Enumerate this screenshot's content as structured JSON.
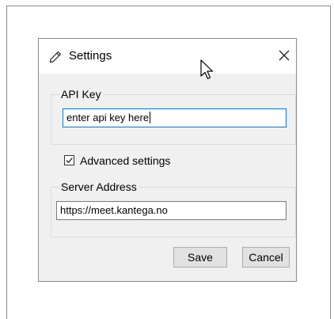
{
  "dialog": {
    "title": "Settings",
    "title_icon": "pencil-icon",
    "close_icon": "close-icon"
  },
  "api_key": {
    "group_label": "API Key",
    "value": "enter api key here"
  },
  "advanced": {
    "label": "Advanced settings",
    "checked": true
  },
  "server": {
    "group_label": "Server Address",
    "value": "https://meet.kantega.no"
  },
  "buttons": {
    "save_label": "Save",
    "cancel_label": "Cancel"
  },
  "colors": {
    "focus_border": "#0078d7",
    "dialog_bg": "#f0f0f0",
    "titlebar_bg": "#ffffff",
    "button_bg": "#e1e1e1"
  }
}
